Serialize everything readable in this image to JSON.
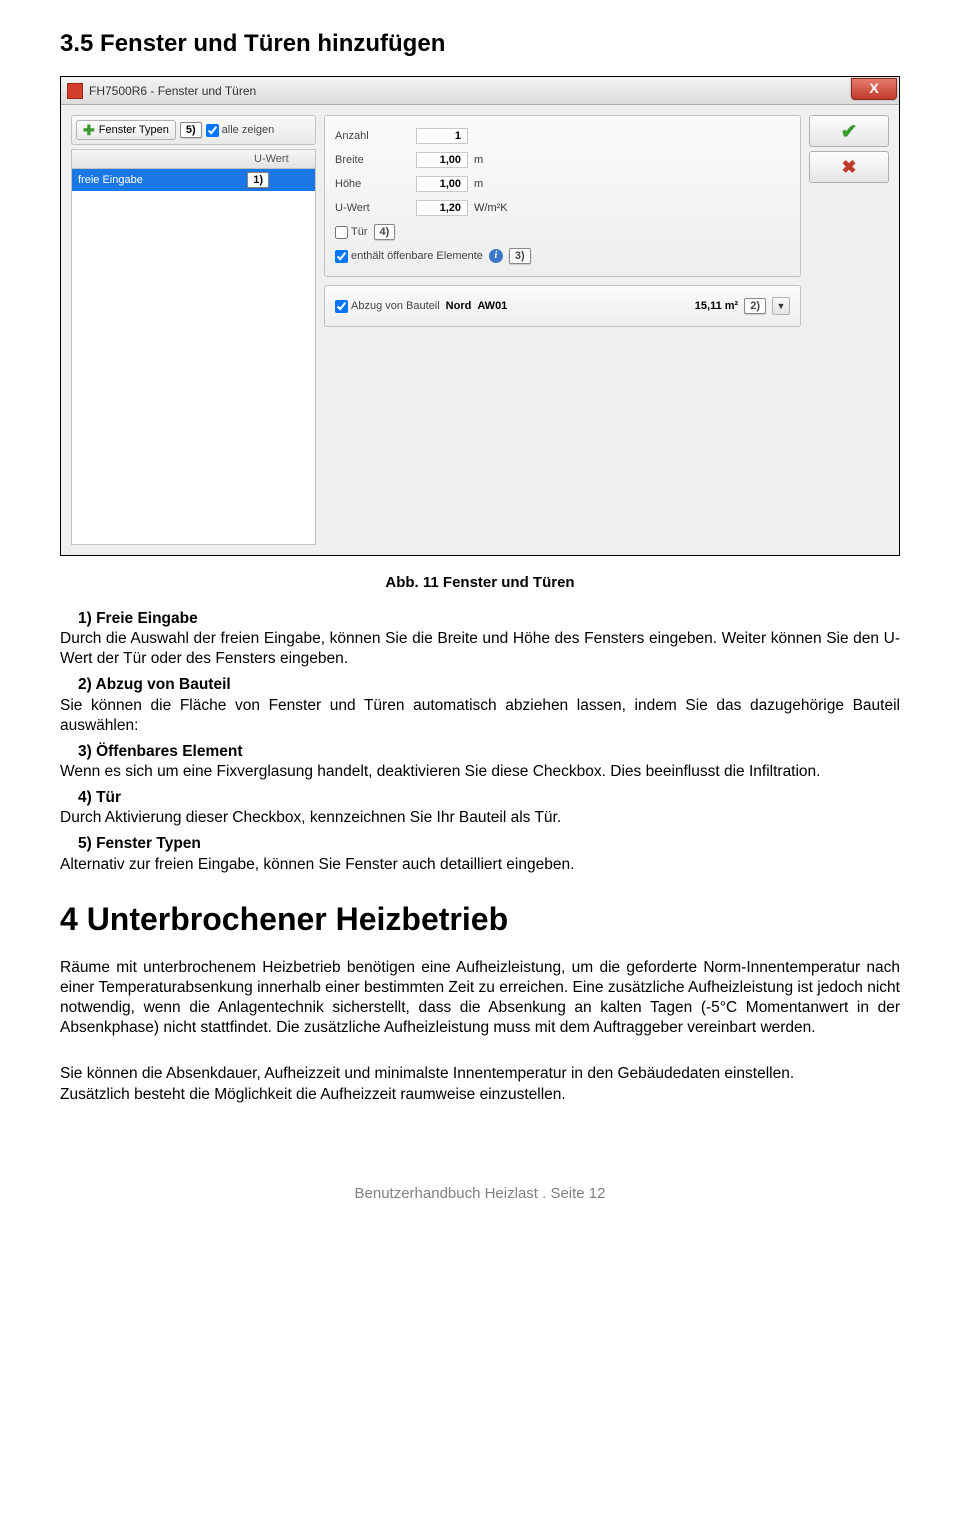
{
  "section_heading": "3.5   Fenster und Türen hinzufügen",
  "dialog": {
    "title": "FH7500R6 - Fenster und Türen",
    "close": "X",
    "toolbar": {
      "add_label": "Fenster Typen",
      "badge5": "5)",
      "show_all": "alle zeigen"
    },
    "list": {
      "col2": "U-Wert",
      "row_name": "freie Eingabe",
      "badge1": "1)"
    },
    "props": {
      "anzahl_label": "Anzahl",
      "anzahl_value": "1",
      "breite_label": "Breite",
      "breite_value": "1,00",
      "breite_unit": "m",
      "hoehe_label": "Höhe",
      "hoehe_value": "1,00",
      "hoehe_unit": "m",
      "uwert_label": "U-Wert",
      "uwert_value": "1,20",
      "uwert_unit": "W/m²K",
      "tuer_label": "Tür",
      "badge4": "4)",
      "offenbar_label": "enthält öffenbare Elemente",
      "badge3": "3)"
    },
    "bauteil": {
      "chk_label": "Abzug von Bauteil",
      "orientation": "Nord",
      "code": "AW01",
      "area": "15,11 m²",
      "badge2": "2)"
    }
  },
  "caption": "Abb. 11 Fenster und Türen",
  "items": {
    "i1_head": "1)    Freie Eingabe",
    "i1_body": "Durch die Auswahl der freien Eingabe, können Sie die Breite und Höhe des Fensters eingeben. Weiter können Sie den U-Wert der Tür oder des Fensters eingeben.",
    "i2_head": "2)    Abzug von Bauteil",
    "i2_body": "Sie können die Fläche von Fenster und Türen automatisch abziehen lassen, indem Sie das dazugehörige Bauteil auswählen:",
    "i3_head": "3)    Öffenbares Element",
    "i3_body": "Wenn es sich um eine Fixverglasung handelt, deaktivieren Sie diese Checkbox. Dies beeinflusst die Infiltration.",
    "i4_head": "4)    Tür",
    "i4_body": "Durch Aktivierung dieser Checkbox, kennzeichnen Sie Ihr Bauteil als Tür.",
    "i5_head": "5)    Fenster Typen",
    "i5_body": "Alternativ zur freien Eingabe, können Sie Fenster auch detailliert eingeben."
  },
  "big_heading": "4    Unterbrochener Heizbetrieb",
  "para1": "Räume mit unterbrochenem Heizbetrieb benötigen eine Aufheizleistung, um die geforderte Norm-Innentemperatur nach einer Temperaturabsenkung innerhalb einer bestimmten Zeit zu erreichen. Eine zusätzliche Aufheizleistung ist jedoch nicht notwendig, wenn die Anlagentechnik sicherstellt, dass die Absenkung an kalten Tagen (-5°C Momentanwert in der Absenkphase) nicht stattfindet. Die zusätzliche Aufheizleistung muss mit dem Auftraggeber vereinbart werden.",
  "para2": "Sie können die Absenkdauer, Aufheizzeit und minimalste Innentemperatur in den Gebäudedaten einstellen.",
  "para3": "Zusätzlich besteht die Möglichkeit die Aufheizzeit raumweise einzustellen.",
  "footer": "Benutzerhandbuch Heizlast  .  Seite 12"
}
